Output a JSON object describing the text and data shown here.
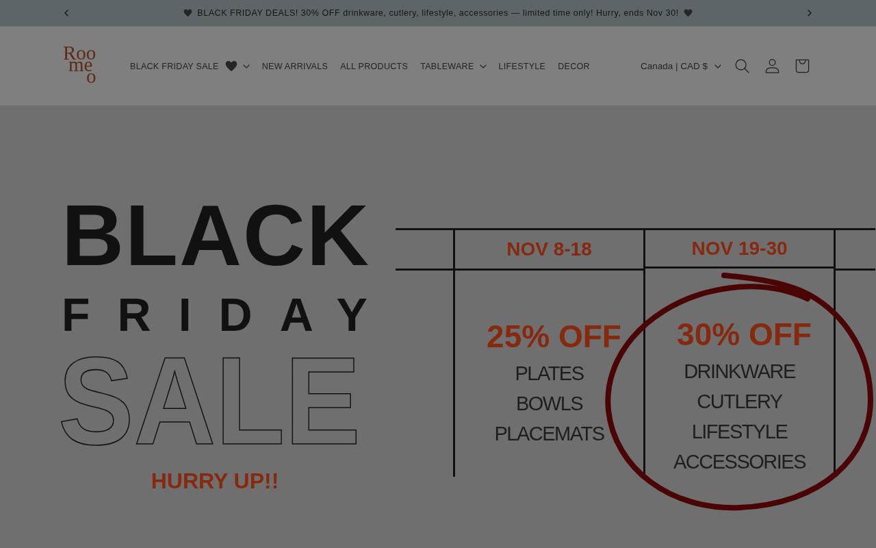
{
  "backdrop": {
    "dimmed": true
  },
  "announcement": {
    "text": "BLACK FRIDAY DEALS! 30% OFF drinkware, cutlery, lifestyle, accessories — limited time only! Hurry, ends Nov 30!"
  },
  "header": {
    "logo": {
      "lines": [
        "Roo",
        "me",
        "o"
      ]
    },
    "nav": [
      {
        "label": "BLACK FRIDAY SALE",
        "kind": "sale",
        "dropdown": true
      },
      {
        "label": "NEW ARRIVALS",
        "kind": "link",
        "dropdown": false
      },
      {
        "label": "ALL PRODUCTS",
        "kind": "link",
        "dropdown": false
      },
      {
        "label": "TABLEWARE",
        "kind": "link",
        "dropdown": true
      },
      {
        "label": "LIFESTYLE",
        "kind": "link",
        "dropdown": false
      },
      {
        "label": "DECOR",
        "kind": "link",
        "dropdown": false
      }
    ],
    "currency": "Canada | CAD $"
  },
  "banner": {
    "heading": "BLACK",
    "subheading": "FRIDAY",
    "outline_heading": "SALE",
    "callout": "HURRY UP!!",
    "sale_table": {
      "columns": [
        {
          "dates": "NOV 8-18",
          "discount": "25% OFF",
          "categories": [
            "PLATES",
            "BOWLS",
            "PLACEMATS"
          ],
          "circled": false
        },
        {
          "dates": "NOV 19-30",
          "discount": "30% OFF",
          "categories": [
            "DRINKWARE",
            "CUTLERY",
            "LIFESTYLE",
            "ACCESSORIES"
          ],
          "circled": true
        }
      ]
    }
  }
}
